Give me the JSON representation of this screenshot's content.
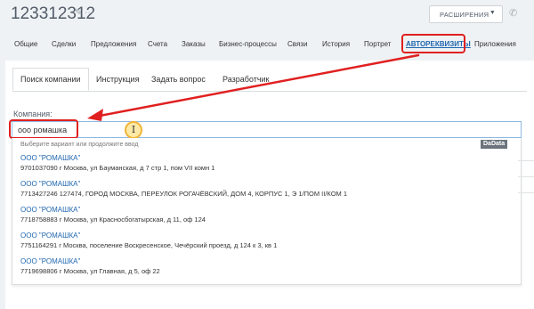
{
  "header": {
    "title": "123312312",
    "extensions_label": "РАСШИРЕНИЯ"
  },
  "tabs": [
    {
      "label": "Общие"
    },
    {
      "label": "Сделки"
    },
    {
      "label": "Предложения"
    },
    {
      "label": "Счета"
    },
    {
      "label": "Заказы"
    },
    {
      "label": "Бизнес-процессы"
    },
    {
      "label": "Связи"
    },
    {
      "label": "История"
    },
    {
      "label": "Портрет"
    },
    {
      "label": "АВТОРЕКВИЗИТЫ"
    },
    {
      "label": "Приложения"
    }
  ],
  "subtabs": [
    {
      "label": "Поиск компании"
    },
    {
      "label": "Инструкция"
    },
    {
      "label": "Задать вопрос"
    },
    {
      "label": "Разработчик"
    }
  ],
  "form": {
    "company_label": "Компания:",
    "company_value": "ооо ромашка"
  },
  "dropdown": {
    "hint": "Выберите вариант или продолжите ввод",
    "provider": "DaData",
    "suggestions": [
      {
        "name": "ООО \"РОМАШКА\"",
        "address": "9701037090  г Москва, ул Бауманская, д 7 стр 1, пом VII комн 1"
      },
      {
        "name": "ООО \"РОМАШКА\"",
        "address": "7713427246  127474, ГОРОД МОСКВА, ПЕРЕУЛОК РОГАЧЁВСКИЙ, ДОМ 4, КОРПУС 1, Э 1/ПОМ II/КОМ 1"
      },
      {
        "name": "ООО \"РОМАШКА\"",
        "address": "7718758883  г Москва, ул Красносбогатырская, д 11, оф 124"
      },
      {
        "name": "ООО \"РОМАШКА\"",
        "address": "7751164291  г Москва, поселение Воскресенское, Чечёрский проезд, д 124 к 3, кв 1"
      },
      {
        "name": "ООО \"РОМАШКА\"",
        "address": "7719698806  г Москва, ул Главная, д 5, оф 22"
      }
    ]
  },
  "colors": {
    "accent": "#2067b0",
    "annotation": "#e02020",
    "cursor_highlight": "#fde9a6"
  }
}
